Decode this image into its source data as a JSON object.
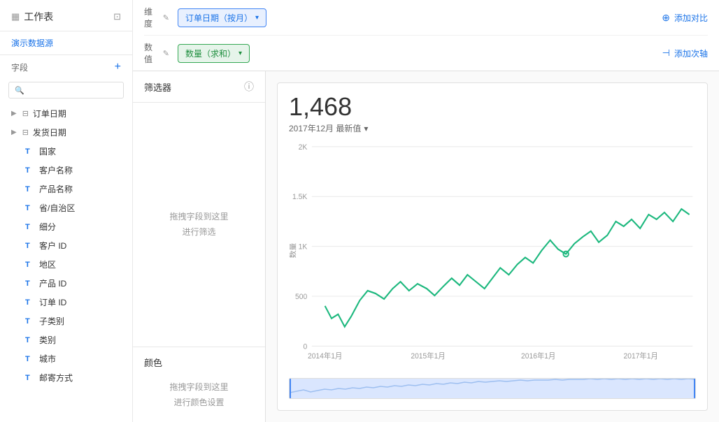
{
  "sidebar": {
    "workspace_label": "工作表",
    "datasource_label": "演示数据源",
    "fields_label": "字段",
    "add_field_icon": "+",
    "search_placeholder": "",
    "fields": [
      {
        "id": "order-date",
        "name": "订单日期",
        "type": "date",
        "expandable": true
      },
      {
        "id": "ship-date",
        "name": "发货日期",
        "type": "date",
        "expandable": true
      },
      {
        "id": "country",
        "name": "国家",
        "type": "text"
      },
      {
        "id": "customer-name",
        "name": "客户名称",
        "type": "text"
      },
      {
        "id": "product-name",
        "name": "产品名称",
        "type": "text"
      },
      {
        "id": "province",
        "name": "省/自治区",
        "type": "text"
      },
      {
        "id": "segment",
        "name": "细分",
        "type": "text"
      },
      {
        "id": "customer-id",
        "name": "客户 ID",
        "type": "text"
      },
      {
        "id": "region",
        "name": "地区",
        "type": "text"
      },
      {
        "id": "product-id",
        "name": "产品 ID",
        "type": "text"
      },
      {
        "id": "order-id",
        "name": "订单 ID",
        "type": "text"
      },
      {
        "id": "subcategory",
        "name": "子类别",
        "type": "text"
      },
      {
        "id": "category",
        "name": "类别",
        "type": "text"
      },
      {
        "id": "city",
        "name": "城市",
        "type": "text"
      },
      {
        "id": "postal-code",
        "name": "邮寄方式",
        "type": "text"
      }
    ]
  },
  "toolbar": {
    "dimension_label": "维度",
    "measure_label": "数值",
    "dimension_value": "订单日期（按月）",
    "measure_value": "数量（求和）",
    "add_compare_label": "添加对比",
    "add_axis_label": "添加次轴",
    "edit_icon": "✎",
    "chevron": "▾"
  },
  "filter": {
    "header": "筛选器",
    "drop_hint": "拖拽字段到这里\n进行筛选",
    "color_header": "颜色",
    "color_drop_hint": "拖拽字段到这里\n进行颜色设置"
  },
  "chart": {
    "main_value": "1,468",
    "subtitle": "2017年12月 最新值",
    "subtitle_chevron": "▾",
    "y_labels": [
      "2K",
      "1.5K",
      "1K",
      "500",
      "0"
    ],
    "x_labels": [
      "2014年1月",
      "2015年1月",
      "2016年1月",
      "2017年1月"
    ],
    "y_axis_label": "数量"
  }
}
